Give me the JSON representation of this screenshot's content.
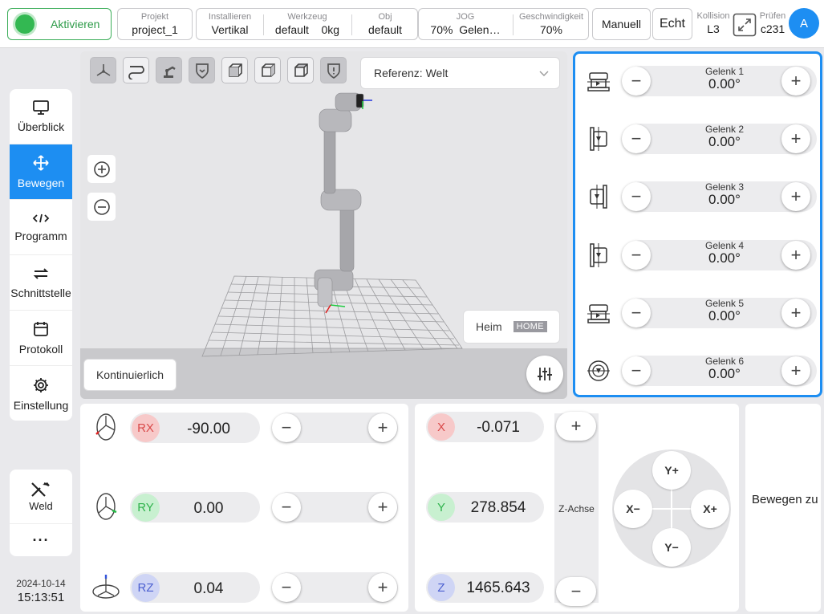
{
  "topbar": {
    "activate_label": "Aktivieren",
    "project": {
      "key": "Projekt",
      "value": "project_1"
    },
    "install": {
      "key": "Installieren",
      "value": "Vertikal"
    },
    "tool": {
      "key": "Werkzeug",
      "value": "default",
      "weight": "0kg"
    },
    "obj": {
      "key": "Obj",
      "value": "default"
    },
    "jog": {
      "key": "JOG",
      "speed": "70%",
      "mode": "Gelen…"
    },
    "speed": {
      "key": "Geschwindigkeit",
      "value": "70%"
    },
    "manual_label": "Manuell",
    "real_label": "Echt",
    "collision": {
      "key": "Kollision",
      "value": "L3"
    },
    "check": {
      "key": "Prüfen",
      "value": "c231"
    },
    "avatar": "A",
    "colors": {
      "accent": "#1d8ef2",
      "active_green": "#33b852"
    }
  },
  "nav": {
    "items": [
      {
        "label": "Überblick",
        "icon": "monitor-icon"
      },
      {
        "label": "Bewegen",
        "icon": "move-icon",
        "active": true
      },
      {
        "label": "Programm",
        "icon": "code-icon"
      },
      {
        "label": "Schnittstelle",
        "icon": "swap-icon"
      },
      {
        "label": "Protokoll",
        "icon": "calendar-icon"
      },
      {
        "label": "Einstellung",
        "icon": "gear-icon"
      }
    ],
    "weld_label": "Weld",
    "more_label": "···"
  },
  "datetime": {
    "date": "2024-10-14",
    "time": "15:13:51"
  },
  "view": {
    "reference": "Referenz: Welt",
    "home_label": "Heim",
    "home_tag": "HOME",
    "continuous_label": "Kontinuierlich"
  },
  "joints": [
    {
      "label": "Gelenk 1",
      "value": "0.00°"
    },
    {
      "label": "Gelenk 2",
      "value": "0.00°"
    },
    {
      "label": "Gelenk 3",
      "value": "0.00°"
    },
    {
      "label": "Gelenk 4",
      "value": "0.00°"
    },
    {
      "label": "Gelenk 5",
      "value": "0.00°"
    },
    {
      "label": "Gelenk 6",
      "value": "0.00°"
    }
  ],
  "rotation": [
    {
      "axis": "RX",
      "value": "-90.00"
    },
    {
      "axis": "RY",
      "value": "0.00"
    },
    {
      "axis": "RZ",
      "value": "0.04"
    }
  ],
  "position": [
    {
      "axis": "X",
      "value": "-0.071"
    },
    {
      "axis": "Y",
      "value": "278.854"
    },
    {
      "axis": "Z",
      "value": "1465.643"
    }
  ],
  "zaxis_label": "Z-Achse",
  "pad": {
    "up": "Y+",
    "down": "Y−",
    "left": "X−",
    "right": "X+"
  },
  "move_to_label": "Bewegen zu",
  "symbols": {
    "minus": "−",
    "plus": "+"
  }
}
